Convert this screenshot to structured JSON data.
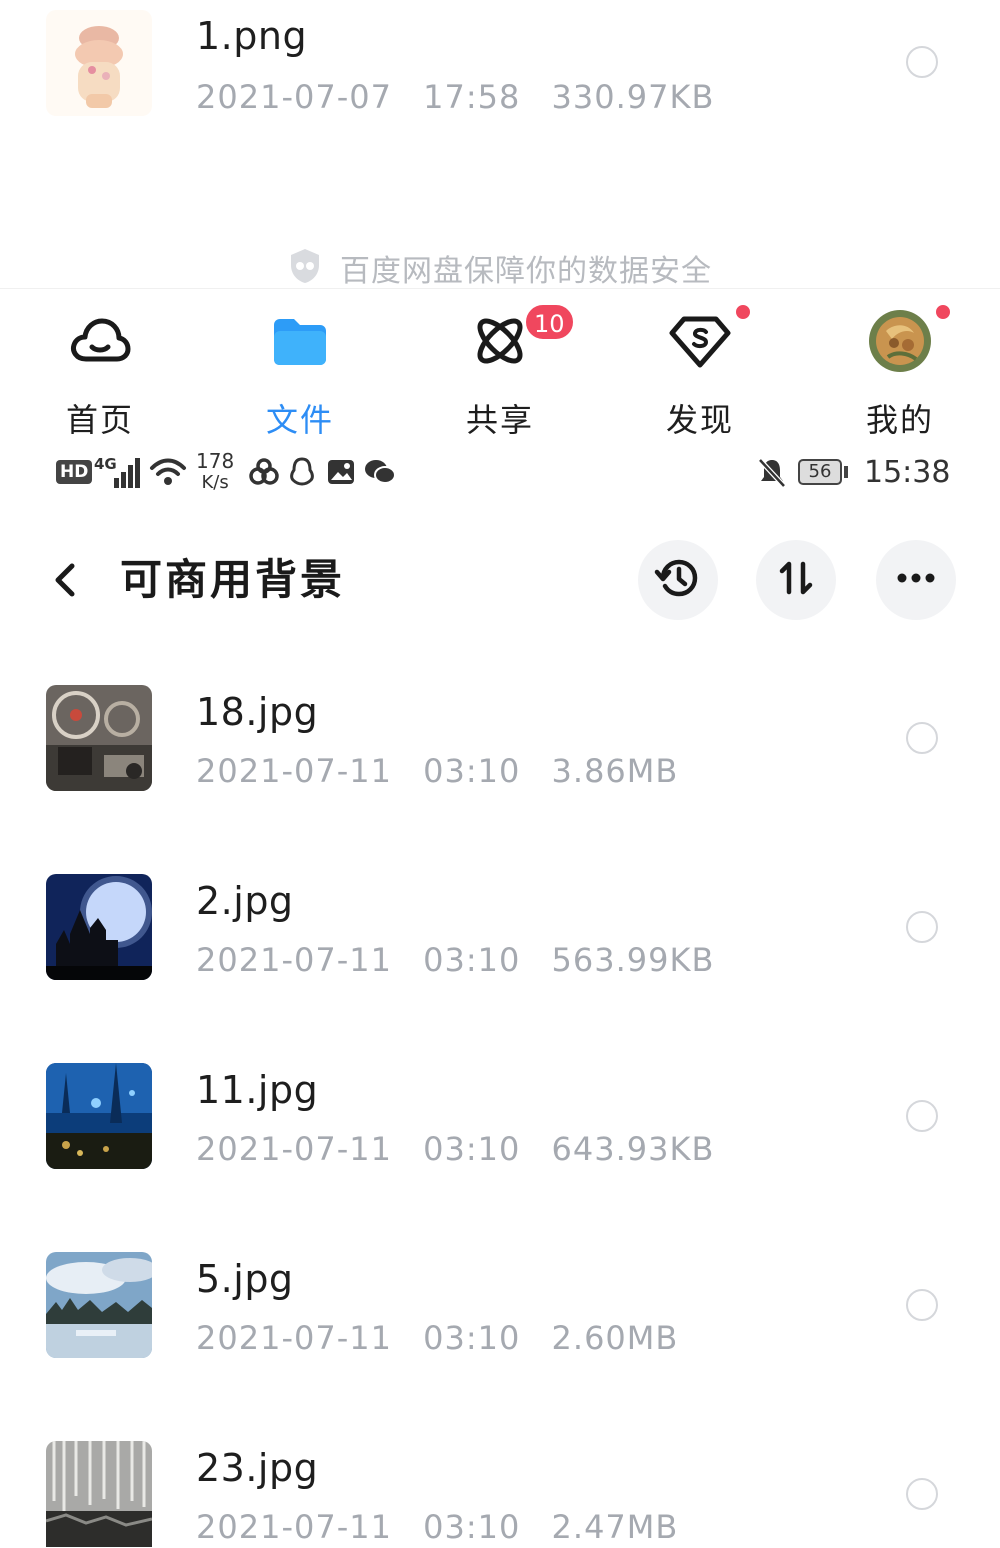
{
  "top_file": {
    "name": "1.png",
    "date": "2021-07-07",
    "time": "17:58",
    "size": "330.97KB"
  },
  "security_note": "百度网盘保障你的数据安全",
  "nav": {
    "items": [
      {
        "label": "首页",
        "icon": "cloud-icon"
      },
      {
        "label": "文件",
        "icon": "folder-icon",
        "active": true
      },
      {
        "label": "共享",
        "icon": "share-atom-icon",
        "badge": "10"
      },
      {
        "label": "发现",
        "icon": "discover-diamond-icon",
        "dot": true
      },
      {
        "label": "我的",
        "icon": "avatar",
        "dot": true
      }
    ]
  },
  "status_bar": {
    "hd": "HD",
    "network": "4G",
    "speed_value": "178",
    "speed_unit": "K/s",
    "battery": "56",
    "time": "15:38"
  },
  "header": {
    "title": "可商用背景",
    "buttons": [
      "history-icon",
      "sort-icon",
      "more-icon"
    ]
  },
  "files": [
    {
      "name": "18.jpg",
      "date": "2021-07-11",
      "time": "03:10",
      "size": "3.86MB"
    },
    {
      "name": "2.jpg",
      "date": "2021-07-11",
      "time": "03:10",
      "size": "563.99KB"
    },
    {
      "name": "11.jpg",
      "date": "2021-07-11",
      "time": "03:10",
      "size": "643.93KB"
    },
    {
      "name": "5.jpg",
      "date": "2021-07-11",
      "time": "03:10",
      "size": "2.60MB"
    },
    {
      "name": "23.jpg",
      "date": "2021-07-11",
      "time": "03:10",
      "size": "2.47MB"
    }
  ],
  "colors": {
    "accent": "#2d8df5",
    "badge": "#f0475e",
    "meta_text": "#a5a9b0"
  }
}
